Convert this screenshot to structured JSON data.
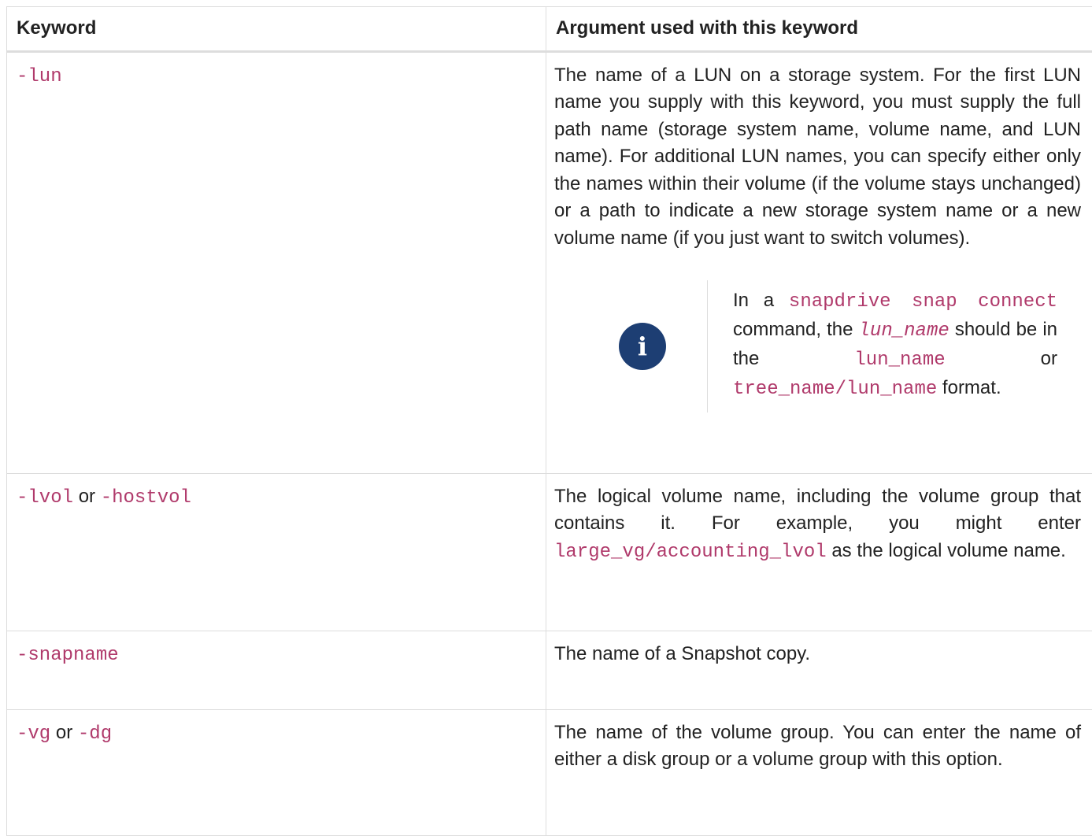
{
  "header": {
    "keyword": "Keyword",
    "argument": "Argument used with this keyword"
  },
  "rows": [
    {
      "keyword_code": "-lun",
      "description": "The name of a LUN on a storage system. For the first LUN name you supply with this keyword, you must supply the full path name (storage system name, volume name, and LUN name). For additional LUN names, you can specify either only the names within their volume (if the volume stays unchanged) or a path to indicate a new storage system name or a new volume name (if you just want to switch volumes).",
      "note": {
        "icon": "info-icon",
        "text_1": "In a",
        "code_1": "snapdrive snap connect",
        "text_2": "command, the",
        "code_2": "lun_name",
        "text_3": "should be in the",
        "code_3": "lun_name",
        "text_4": "or",
        "code_4": "tree_name/lun_name",
        "text_5": "format."
      }
    },
    {
      "keyword_code_1": "-lvol",
      "keyword_sep": "or",
      "keyword_code_2": "-hostvol",
      "description_1": "The logical volume name, including the volume group that contains it. For example, you might enter",
      "description_code": "large_vg/accounting_lvol",
      "description_2": "as the logical volume name."
    },
    {
      "keyword_code": "-snapname",
      "description": "The name of a Snapshot copy."
    },
    {
      "keyword_code_1": "-vg",
      "keyword_sep": "or",
      "keyword_code_2": "-dg",
      "description": "The name of the volume group. You can enter the name of either a disk group or a volume group with this option."
    }
  ],
  "colors": {
    "code": "#b03a6b",
    "icon_bg": "#1d3e73",
    "border": "#dddddd",
    "text": "#222222"
  }
}
